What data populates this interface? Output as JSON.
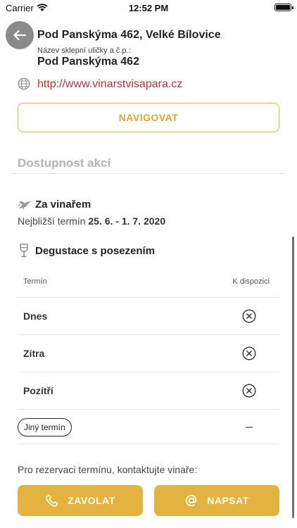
{
  "status_bar": {
    "carrier": "Carrier",
    "time": "12:52 PM"
  },
  "address": {
    "title": "Pod Panskýma 462, Velké Bílovice",
    "cellar_label": "Název sklepní uličky a č.p.:",
    "cellar_value": "Pod Panskýma 462"
  },
  "website": {
    "url": "http://www.vinarstvisapara.cz",
    "icon": "globe-icon"
  },
  "navigate_label": "NAVIGOVAT",
  "events_section": {
    "heading": "Dostupnost akcí",
    "event": {
      "icon": "bird-icon",
      "title": "Za vinařem",
      "term_prefix": "Nejbližší termín",
      "term_dates": "25. 6. - 1. 7. 2020"
    },
    "tasting": {
      "icon": "wine-glass-icon",
      "title": "Degustace s posezením",
      "col_term": "Termín",
      "col_avail": "K dispozici",
      "rows": [
        {
          "label": "Dnes",
          "status": "unavailable"
        },
        {
          "label": "Zítra",
          "status": "unavailable"
        },
        {
          "label": "Pozítří",
          "status": "unavailable"
        }
      ],
      "other_term_label": "Jiný termín"
    }
  },
  "contact": {
    "text": "Pro rezervaci termínu, kontaktujte vinaře:",
    "call_label": "ZAVOLAT",
    "write_label": "NAPSAT"
  },
  "colors": {
    "accent": "#e2b43f",
    "link": "#b5323a",
    "muted": "#b3b3b3"
  }
}
